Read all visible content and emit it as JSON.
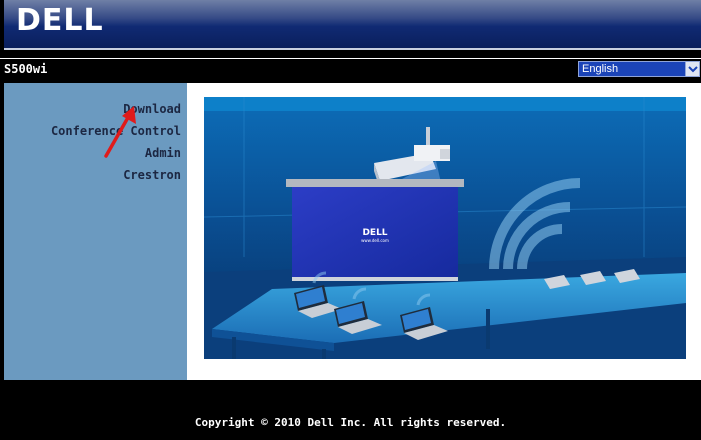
{
  "header": {
    "logo_text": "DELL",
    "model_name": "S500wi"
  },
  "language": {
    "selected": "English"
  },
  "sidebar": {
    "items": [
      {
        "label": "Download"
      },
      {
        "label": "Conference Control"
      },
      {
        "label": "Admin"
      },
      {
        "label": "Crestron"
      }
    ]
  },
  "hero": {
    "screen_logo": "DELL",
    "screen_url": "www.dell.com"
  },
  "footer": {
    "copyright": "Copyright © 2010 Dell Inc. All rights reserved."
  },
  "colors": {
    "banner": "#102a73",
    "sidebar": "#6b9ac0",
    "menu_text": "#1c2742",
    "language_select": "#1b44b8",
    "annotation_arrow": "#e01b1b"
  },
  "icons": [
    "chevron-down-icon",
    "annotation-arrow-icon"
  ]
}
